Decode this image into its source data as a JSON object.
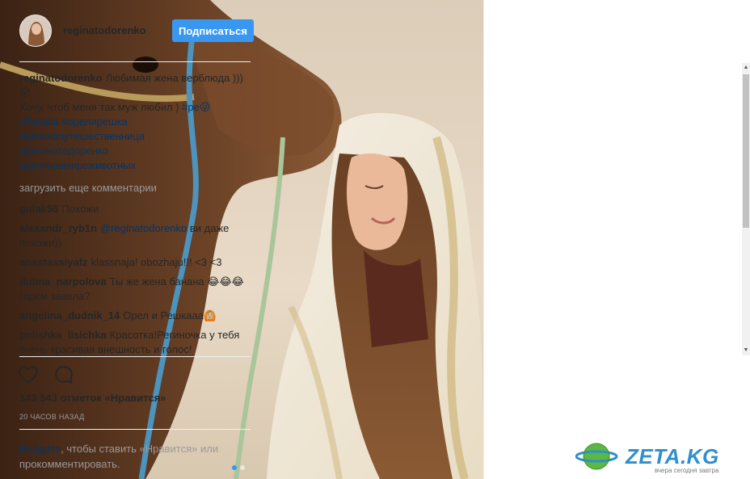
{
  "post": {
    "author": "reginatodorenko",
    "follow_label": "Подписаться",
    "caption": {
      "username": "reginatodorenko",
      "line1": "Любимая жена верблюда ))) 😮",
      "line2": "Хочу, чтоб меня так муж любил ) ",
      "line2_tag": "#ре😜",
      "hashtags": [
        "#Tunisia",
        "#орелирешка",
        "#регинапутешественница",
        "#регинатодоренко",
        "#регинавмиреживотных"
      ]
    },
    "load_more": "загрузить еще комментарии",
    "comments": [
      {
        "user": "gulak56",
        "text": "Похожи"
      },
      {
        "user": "alexandr_ryb1n",
        "mention": "@reginatodorenko",
        "text": " ви даже похожи))"
      },
      {
        "user": "anastassiyafz",
        "text": "klassnaja! obozhaju!!! <3 <3"
      },
      {
        "user": "dulma_narpolova",
        "text": "Ты же жена банана 😂😂😂 гарем завела?"
      },
      {
        "user": "angelina_dudnik_14",
        "text": "Орел и Решкааа🙆🏼"
      },
      {
        "user": "polishka_lisichka",
        "text": "Красотка!Региночка у тебя очень красивая внешность и голос!"
      }
    ],
    "likes": "143 543 отметок «Нравится»",
    "time": "20 часов назад",
    "login": {
      "link": "Войдите",
      "rest": ", чтобы ставить «Нравится» или прокомментировать."
    },
    "carousel_dots": 2,
    "carousel_active": 0
  },
  "icons": {
    "like": "heart-icon",
    "comment": "comment-bubble-icon"
  },
  "watermark": {
    "text": "ZETA.KG",
    "sub": "вчера сегодня завтра"
  },
  "colors": {
    "accent": "#3897f0",
    "link": "#003569",
    "muted": "#999999"
  }
}
